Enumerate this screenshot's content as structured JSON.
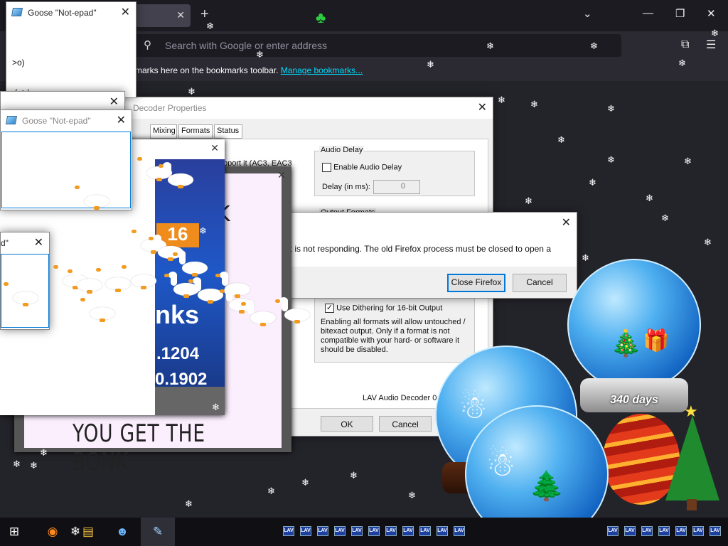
{
  "browser": {
    "search_placeholder": "Search with Google or enter address",
    "bookmarks_hint": "marks here on the bookmarks toolbar.",
    "manage_bookmarks": "Manage bookmarks..."
  },
  "notepad": {
    "title": "Goose \"Not-epad\"",
    "content_line1": ">o)",
    "content_line2": " (_>|",
    "partial_title": "d\""
  },
  "lav_dialog": {
    "title": "Decoder Properties",
    "tabs": [
      "Mixing",
      "Formats",
      "Status"
    ],
    "support_text": "pport it (AC3, EAC3",
    "audio_delay_legend": "Audio Delay",
    "enable_audio_delay": "Enable Audio Delay",
    "delay_label": "Delay (in ms):",
    "delay_value": "0",
    "output_formats_legend": "Output Formats",
    "dithering_label": "Use Dithering for 16-bit Output",
    "formats_info": "Enabling all formats will allow untouched / bitexact output. Only if a format is not compatible with your hard- or software it should be disabled.",
    "version": "LAV Audio Decoder 0.7",
    "ok": "OK",
    "cancel": "Cancel"
  },
  "ff_alert": {
    "message": "ut is not responding. The old Firefox process must be closed to open a",
    "close_firefox": "Close Firefox",
    "cancel": "Cancel"
  },
  "meme": {
    "top_text": "K",
    "ticker_text": "nks",
    "number1": ".1204",
    "number2": "0.1902",
    "bottom_text": "YOU GET THE BONK",
    "logo_text": "16"
  },
  "globes": {
    "label": "340 days"
  },
  "taskbar": {
    "lav_tray_label": "LAV",
    "icons": [
      "windows-start",
      "firefox",
      "snowflake",
      "file-explorer",
      "people",
      "notepad"
    ]
  }
}
